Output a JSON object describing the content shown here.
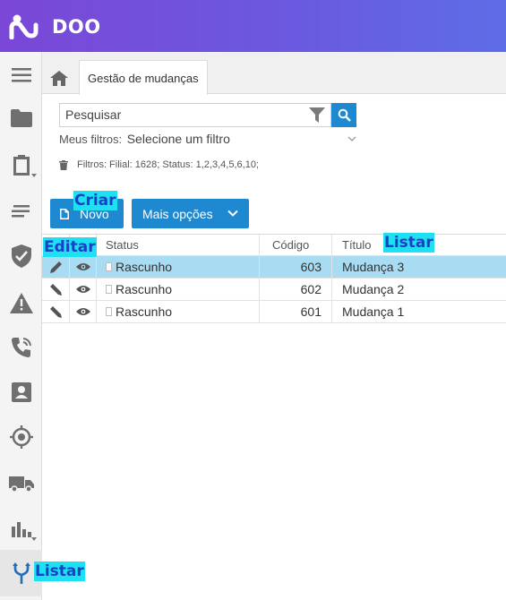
{
  "app": {
    "brand": "DOO"
  },
  "colors": {
    "header_start": "#7a47d6",
    "header_end": "#5e6de6",
    "primary": "#1e88d0",
    "selected_row": "#a8dcf2",
    "annotation_bg": "#1fe0f0",
    "annotation_text": "#1a3fc8"
  },
  "sidebar": {
    "items": [
      {
        "icon": "menu-icon"
      },
      {
        "icon": "folder-icon"
      },
      {
        "icon": "clipboard-icon"
      },
      {
        "icon": "lines-icon"
      },
      {
        "icon": "shield-check-icon"
      },
      {
        "icon": "warning-icon"
      },
      {
        "icon": "phone-icon"
      },
      {
        "icon": "contact-card-icon"
      },
      {
        "icon": "target-icon"
      },
      {
        "icon": "truck-icon"
      },
      {
        "icon": "bar-chart-icon"
      },
      {
        "icon": "fork-icon"
      }
    ]
  },
  "tabs": {
    "active_label": "Gestão de mudanças"
  },
  "search": {
    "placeholder": "Pesquisar"
  },
  "filters": {
    "label": "Meus filtros:",
    "selected": "Selecione um filtro",
    "summary": "Filtros: Filial: 1628; Status: 1,2,3,4,5,6,10;"
  },
  "toolbar": {
    "new_label": "Novo",
    "more_label": "Mais opções"
  },
  "table": {
    "headers": {
      "status": "Status",
      "code": "Código",
      "title": "Título"
    },
    "rows": [
      {
        "status": "Rascunho",
        "code": "603",
        "title": "Mudança 3"
      },
      {
        "status": "Rascunho",
        "code": "602",
        "title": "Mudança 2"
      },
      {
        "status": "Rascunho",
        "code": "601",
        "title": "Mudança 1"
      }
    ]
  },
  "annotations": {
    "create": "Criar",
    "edit": "Editar",
    "list": "Listar",
    "list_sidebar": "Listar"
  }
}
